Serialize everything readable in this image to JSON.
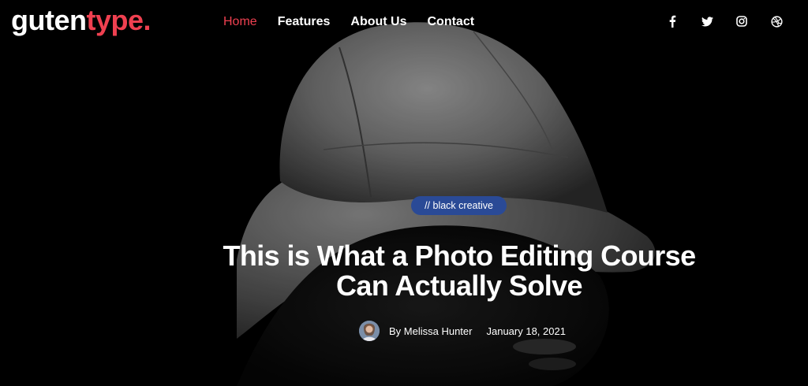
{
  "brand": {
    "logo_part1": "guten",
    "logo_part2": "type."
  },
  "nav": {
    "items": [
      "Home",
      "Features",
      "About Us",
      "Contact"
    ],
    "active": "Home"
  },
  "social": [
    "facebook-icon",
    "twitter-icon",
    "instagram-icon",
    "dribbble-icon"
  ],
  "post": {
    "category": "// black creative",
    "title_line1": "This is What a Photo Editing Course",
    "title_line2": "Can Actually Solve",
    "author": "By Melissa Hunter",
    "date": "January 18, 2021"
  },
  "colors": {
    "accent": "#ef4050",
    "tag_bg": "#2a4a96",
    "background": "#000000"
  }
}
